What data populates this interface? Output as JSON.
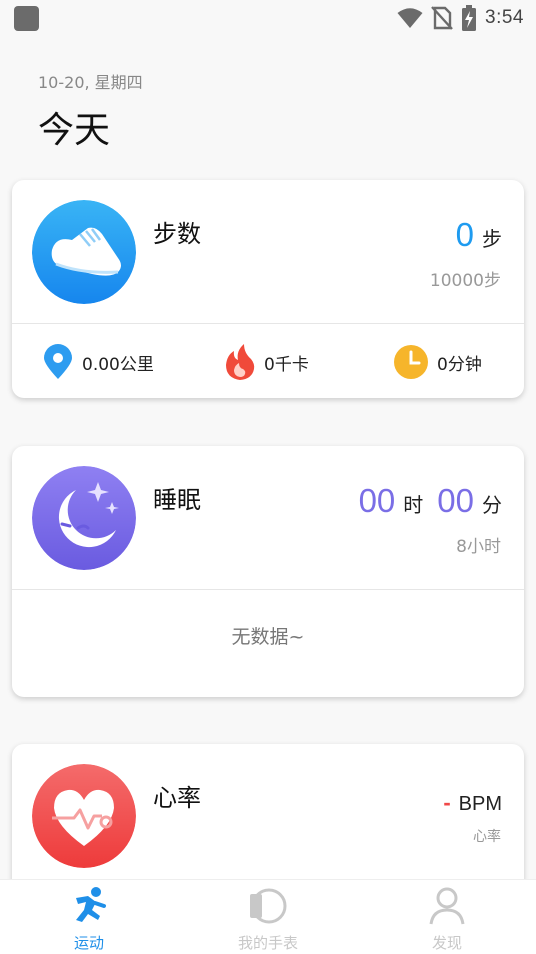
{
  "status_bar": {
    "time": "3:54",
    "icons": [
      "app-notification-icon",
      "wifi-icon",
      "no-sim-icon",
      "battery-charging-icon"
    ]
  },
  "header": {
    "date": "10-20, 星期四",
    "title": "今天"
  },
  "steps_card": {
    "title": "步数",
    "value": "0",
    "unit": "步",
    "goal": "10000步",
    "icon": "shoe-icon",
    "metrics": [
      {
        "icon": "location-pin-icon",
        "value": "0.00公里"
      },
      {
        "icon": "flame-icon",
        "value": "0千卡"
      },
      {
        "icon": "clock-icon",
        "value": "0分钟"
      }
    ]
  },
  "sleep_card": {
    "title": "睡眠",
    "hours": "00",
    "hours_unit": "时",
    "minutes": "00",
    "minutes_unit": "分",
    "goal": "8小时",
    "empty_text": "无数据~",
    "icon": "moon-icon"
  },
  "heart_card": {
    "title": "心率",
    "value": "-",
    "unit": "BPM",
    "sub_label": "心率",
    "icon": "heart-icon"
  },
  "tab_bar": {
    "tabs": [
      {
        "label": "运动",
        "icon": "running-icon",
        "active": true
      },
      {
        "label": "我的手表",
        "icon": "watch-icon",
        "active": false
      },
      {
        "label": "发现",
        "icon": "person-icon",
        "active": false
      }
    ]
  },
  "colors": {
    "steps_accent": "#1e9bf0",
    "sleep_accent": "#7a6ee6",
    "heart_accent": "#f04848",
    "tab_active": "#1f8fe8",
    "tab_inactive": "#c8c8c8"
  }
}
